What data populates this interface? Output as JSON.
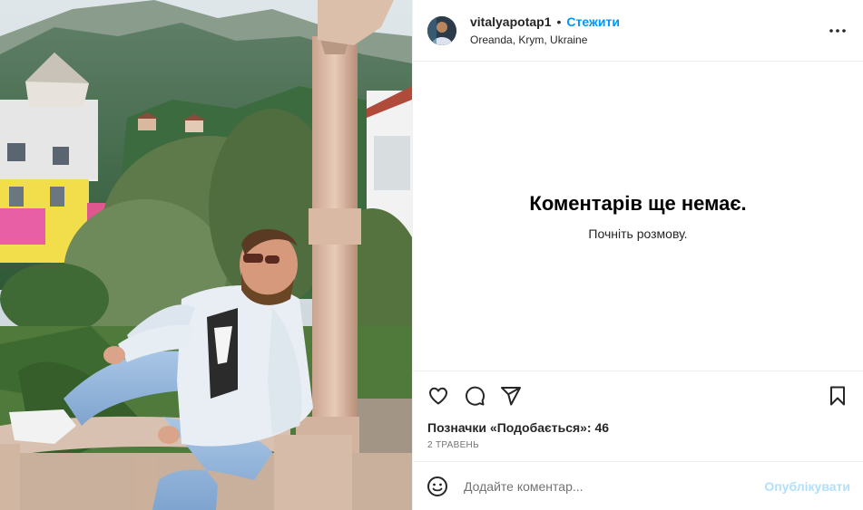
{
  "post": {
    "username": "vitalyapotap1",
    "separator": "•",
    "follow_label": "Стежити",
    "location": "Oreanda, Krym, Ukraine",
    "more_icon": "more-horizontal-icon"
  },
  "comments": {
    "empty_title": "Коментарів ще немає.",
    "empty_subtitle": "Почніть розмову."
  },
  "actions": {
    "like_icon": "heart-icon",
    "comment_icon": "comment-icon",
    "share_icon": "paper-plane-icon",
    "save_icon": "bookmark-icon"
  },
  "likes_text": "Позначки «Подобається»: 46",
  "date_text": "2 ТРАВЕНЬ",
  "add_comment": {
    "emoji_icon": "emoji-icon",
    "placeholder": "Додайте коментар...",
    "publish_label": "Опублікувати"
  },
  "colors": {
    "accent": "#0095f6",
    "publish_disabled": "#b2dffc",
    "border": "#efefef"
  }
}
